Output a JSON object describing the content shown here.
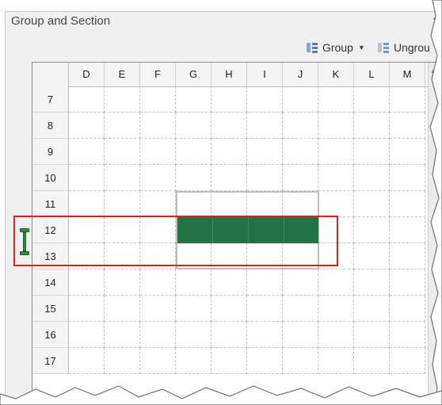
{
  "panel": {
    "title": "Group and Section"
  },
  "toolbar": {
    "group_label": "Group",
    "ungroup_label": "Ungrou"
  },
  "grid": {
    "columns": [
      "D",
      "E",
      "F",
      "G",
      "H",
      "I",
      "J",
      "K",
      "L",
      "M"
    ],
    "rows": [
      "7",
      "8",
      "9",
      "10",
      "11",
      "12",
      "13",
      "14",
      "15",
      "16",
      "17"
    ],
    "section": {
      "columns": "G:J",
      "rows": "11:13",
      "filled_row": "12"
    }
  },
  "colors": {
    "section_fill": "#217346",
    "highlight": "#e02020",
    "marker": "#2e8b3f"
  },
  "icons": [
    "group-icon",
    "ungroup-icon",
    "dropdown-caret-icon",
    "row-group-marker-icon"
  ]
}
